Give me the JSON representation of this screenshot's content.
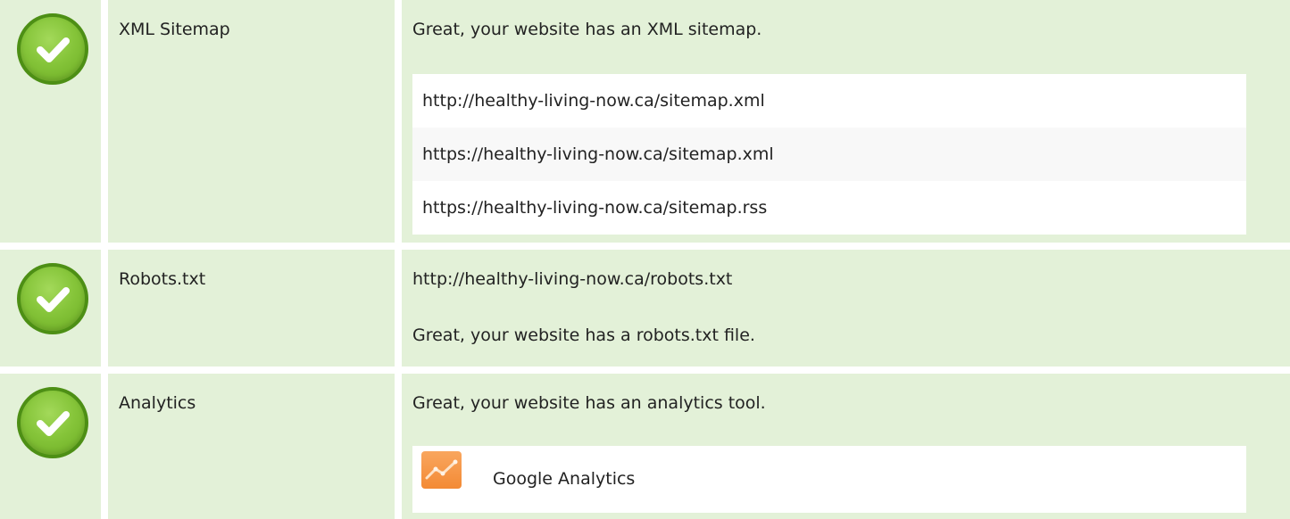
{
  "rows": [
    {
      "name": "XML Sitemap",
      "message": "Great, your website has an XML sitemap.",
      "urls": [
        "http://healthy-living-now.ca/sitemap.xml",
        "https://healthy-living-now.ca/sitemap.xml",
        "https://healthy-living-now.ca/sitemap.rss"
      ]
    },
    {
      "name": "Robots.txt",
      "url": "http://healthy-living-now.ca/robots.txt",
      "message": "Great, your website has a robots.txt file."
    },
    {
      "name": "Analytics",
      "message": "Great, your website has an analytics tool.",
      "tool": {
        "name": "Google Analytics",
        "icon": "google-analytics-icon"
      }
    }
  ],
  "status_icon": "check-circle-icon",
  "colors": {
    "row_background": "#e3f1d8",
    "check_green": "#86c53a",
    "ga_orange": "#f38a35"
  }
}
